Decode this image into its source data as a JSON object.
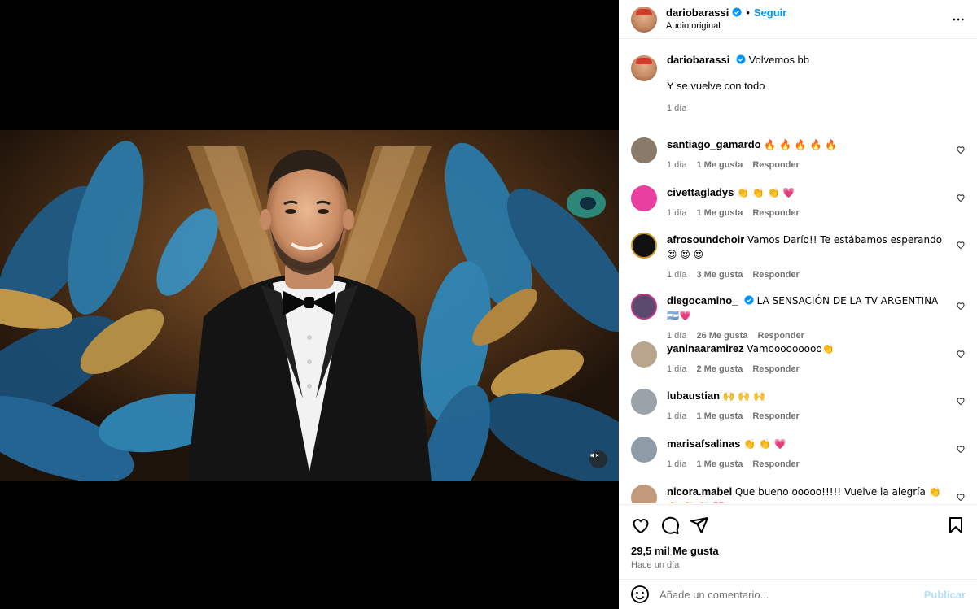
{
  "post": {
    "owner": "dariobarassi",
    "follow_label": "Seguir",
    "audio": "Audio original",
    "more_icon": "more-horizontal-icon"
  },
  "caption": {
    "user": "dariobarassi",
    "text": "Volvemos bb",
    "extra": "Y se vuelve con todo",
    "time": "1 día"
  },
  "comments": [
    {
      "user": "santiago_gamardo",
      "verified": false,
      "text": "🔥 🔥 🔥 🔥 🔥",
      "time": "1 día",
      "likes": "1 Me gusta",
      "reply": "Responder",
      "avatar_color": "#8a7a6a"
    },
    {
      "user": "civettagladys",
      "verified": false,
      "text": "👏 👏 👏 💗",
      "time": "1 día",
      "likes": "1 Me gusta",
      "reply": "Responder",
      "avatar_color": "#e83fa0"
    },
    {
      "user": "afrosoundchoir",
      "verified": false,
      "text": "Vamos Darío!! Te estábamos esperando 😍 😍 😍",
      "time": "1 día",
      "likes": "3 Me gusta",
      "reply": "Responder",
      "avatar_color": "#111111"
    },
    {
      "user": "diegocamino_",
      "verified": true,
      "text": "LA SENSACIÓN DE LA TV ARGENTINA 🇦🇷💗",
      "time": "1 día",
      "likes": "26 Me gusta",
      "reply": "Responder",
      "avatar_color": "#5b4a6e"
    },
    {
      "user": "yaninaaramirez",
      "verified": false,
      "text": "Vamooooooooo👏",
      "time": "1 día",
      "likes": "2 Me gusta",
      "reply": "Responder",
      "avatar_color": "#b9a48d"
    },
    {
      "user": "lubaustian",
      "verified": false,
      "text": "🙌 🙌 🙌",
      "time": "1 día",
      "likes": "1 Me gusta",
      "reply": "Responder",
      "avatar_color": "#9aa3a8"
    },
    {
      "user": "marisafsalinas",
      "verified": false,
      "text": "👏 👏 💗",
      "time": "1 día",
      "likes": "1 Me gusta",
      "reply": "Responder",
      "avatar_color": "#8d9ca6"
    },
    {
      "user": "nicora.mabel",
      "verified": false,
      "text": "Que bueno ooooo!!!!! Vuelve la alegría 👏 👏 👏 👏 💗",
      "time": "",
      "likes": "",
      "reply": "",
      "avatar_color": "#c09a7a"
    }
  ],
  "actions": {
    "like_icon": "heart-icon",
    "comment_icon": "comment-bubble-icon",
    "share_icon": "send-icon",
    "save_icon": "bookmark-icon",
    "likes_count": "29,5 mil Me gusta",
    "date": "Hace un día"
  },
  "comment_box": {
    "placeholder": "Añade un comentario...",
    "publish_label": "Publicar",
    "emoji_icon": "emoji-smile-icon"
  },
  "video": {
    "mute_icon": "muted-speaker-icon"
  },
  "colors": {
    "accent": "#0095f6",
    "verified": "#0095f6",
    "publish_disabled": "#b2dffc",
    "meta_text": "#737373"
  }
}
